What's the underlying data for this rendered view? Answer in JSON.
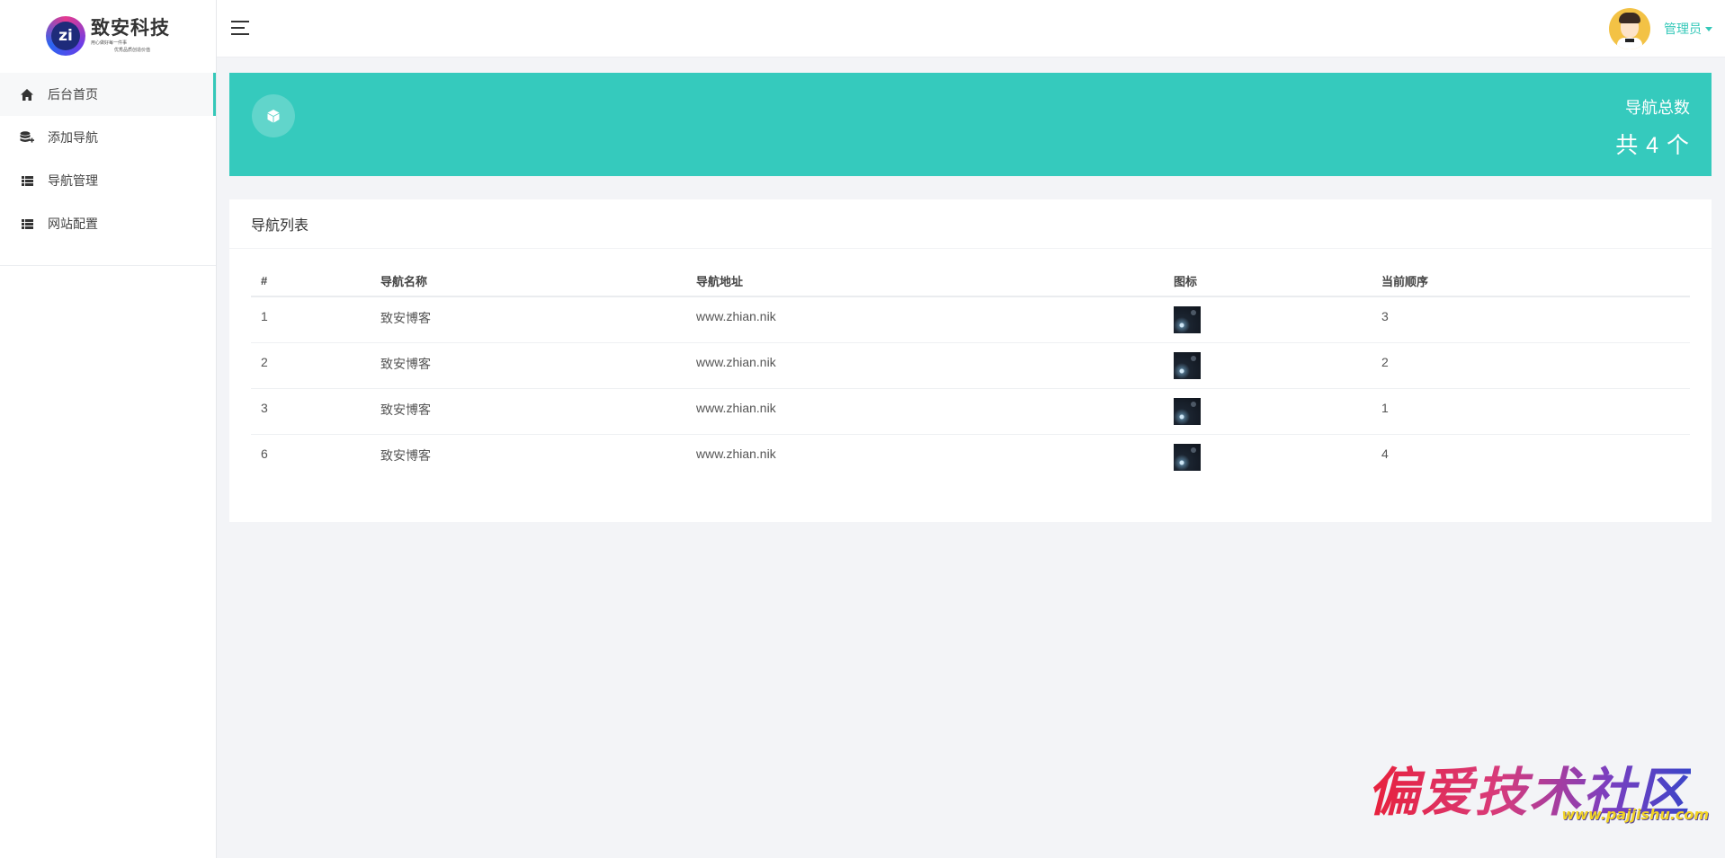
{
  "brand": {
    "title": "致安科技",
    "mark": "zi",
    "slogan1": "用心做好每一件事",
    "slogan2": "优秀品质创造价值"
  },
  "sidebar": {
    "items": [
      {
        "label": "后台首页",
        "icon": "home-icon",
        "active": true
      },
      {
        "label": "添加导航",
        "icon": "database-add-icon",
        "active": false
      },
      {
        "label": "导航管理",
        "icon": "list-icon",
        "active": false
      },
      {
        "label": "网站配置",
        "icon": "list-icon",
        "active": false
      }
    ]
  },
  "header": {
    "user_name": "管理员"
  },
  "stat": {
    "label": "导航总数",
    "value": "共 4 个",
    "icon": "cube-icon"
  },
  "table": {
    "title": "导航列表",
    "columns": [
      "#",
      "导航名称",
      "导航地址",
      "图标",
      "当前顺序"
    ],
    "rows": [
      {
        "id": "1",
        "name": "致安博客",
        "url": "www.zhian.nik",
        "order": "3"
      },
      {
        "id": "2",
        "name": "致安博客",
        "url": "www.zhian.nik",
        "order": "2"
      },
      {
        "id": "3",
        "name": "致安博客",
        "url": "www.zhian.nik",
        "order": "1"
      },
      {
        "id": "6",
        "name": "致安博客",
        "url": "www.zhian.nik",
        "order": "4"
      }
    ]
  },
  "watermark": {
    "text": "偏爱技术社区",
    "url": "www.pajjishu.com"
  },
  "colors": {
    "accent": "#35cabd",
    "sidebar_active_bar": "#35c8b9",
    "user_name": "#35c8b9"
  }
}
